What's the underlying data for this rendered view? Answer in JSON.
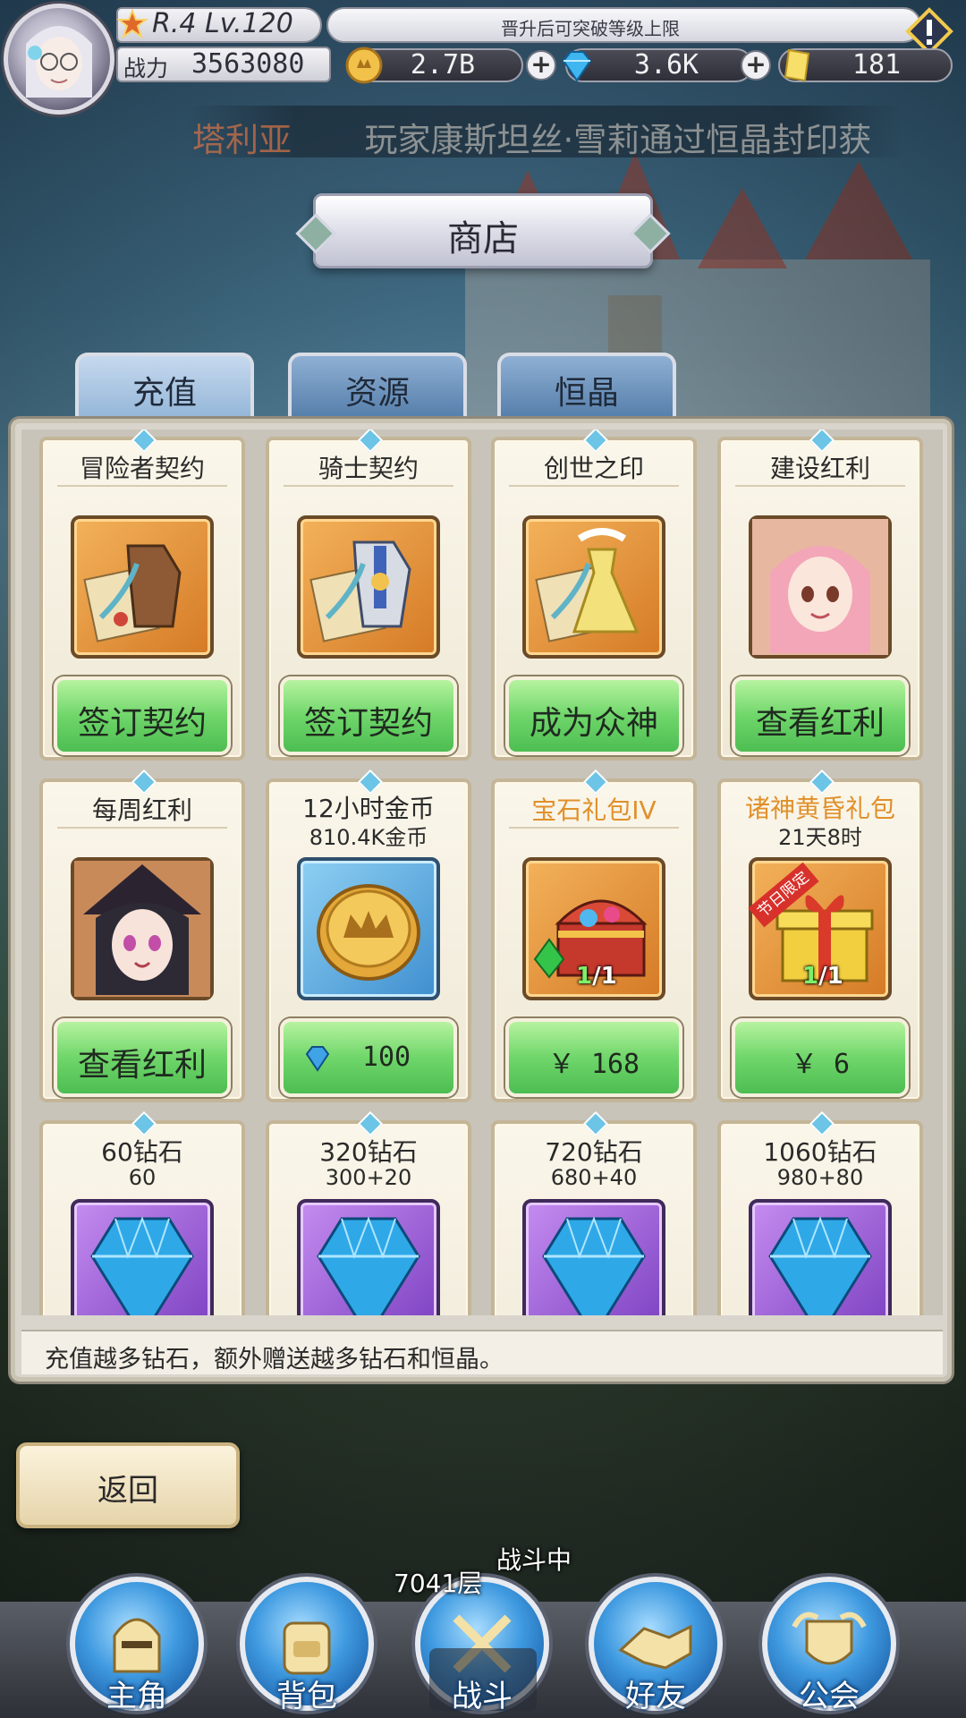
{
  "player": {
    "rank_level": "R.4 Lv.120",
    "power_label": "战力",
    "power_value": "3563080"
  },
  "notice": "晋升后可突破等级上限",
  "currencies": [
    {
      "icon": "gold-coin-icon",
      "value": "2.7B"
    },
    {
      "icon": "blue-diamond-icon",
      "value": "3.6K"
    },
    {
      "icon": "yellow-crystal-icon",
      "value": "181"
    }
  ],
  "marquee": {
    "highlight": "塔利亚",
    "text": "玩家康斯坦丝·雪莉通过恒晶封印获"
  },
  "shop": {
    "title": "商店",
    "tabs": [
      {
        "label": "充值",
        "active": true
      },
      {
        "label": "资源",
        "active": false
      },
      {
        "label": "恒晶",
        "active": false
      }
    ],
    "footer": "充值越多钻石，额外赠送越多钻石和恒晶。"
  },
  "cards_row1": [
    {
      "name": "冒险者契约",
      "icon": "leather-armor-contract-icon",
      "button": "签订契约"
    },
    {
      "name": "骑士契约",
      "icon": "knight-armor-contract-icon",
      "button": "签订契约"
    },
    {
      "name": "创世之印",
      "icon": "golden-dress-contract-icon",
      "button": "成为众神"
    },
    {
      "name": "建设红利",
      "icon": "pink-hair-girl-portrait-icon",
      "button": "查看红利"
    }
  ],
  "cards_row2": [
    {
      "name": "每周红利",
      "sub": "",
      "icon": "witch-girl-portrait-icon",
      "button": "查看红利"
    },
    {
      "name": "12小时金币",
      "sub": "810.4K金币",
      "icon": "crown-coin-icon",
      "price": "100"
    },
    {
      "name": "宝石礼包IV",
      "sub": "",
      "icon": "treasure-chest-icon",
      "qty_have": "1",
      "qty_total": "/1",
      "price": "￥ 168"
    },
    {
      "name": "诸神黄昏礼包",
      "sub": "21天8时",
      "icon": "gift-box-icon",
      "tag": "节日限定",
      "qty_have": "1",
      "qty_total": "/1",
      "price": "￥ 6"
    }
  ],
  "cards_row3": [
    {
      "name": "60钻石",
      "sub": "60",
      "icon": "diamond-icon"
    },
    {
      "name": "320钻石",
      "sub": "300+20",
      "icon": "diamond-icon"
    },
    {
      "name": "720钻石",
      "sub": "680+40",
      "icon": "diamond-icon"
    },
    {
      "name": "1060钻石",
      "sub": "980+80",
      "icon": "diamond-icon"
    }
  ],
  "back_label": "返回",
  "battle": {
    "floor": "7041层",
    "status": "战斗中"
  },
  "nav": [
    {
      "label": "主角",
      "icon": "knight-helmet-icon"
    },
    {
      "label": "背包",
      "icon": "backpack-icon"
    },
    {
      "label": "战斗",
      "icon": "crossed-swords-icon"
    },
    {
      "label": "好友",
      "icon": "handshake-icon"
    },
    {
      "label": "公会",
      "icon": "guild-crest-icon"
    }
  ],
  "colors": {
    "accent_green": "#6fd66a",
    "tab_blue": "#4f79a6",
    "orange_name": "#e0902a",
    "limited_red": "#d8312b"
  }
}
